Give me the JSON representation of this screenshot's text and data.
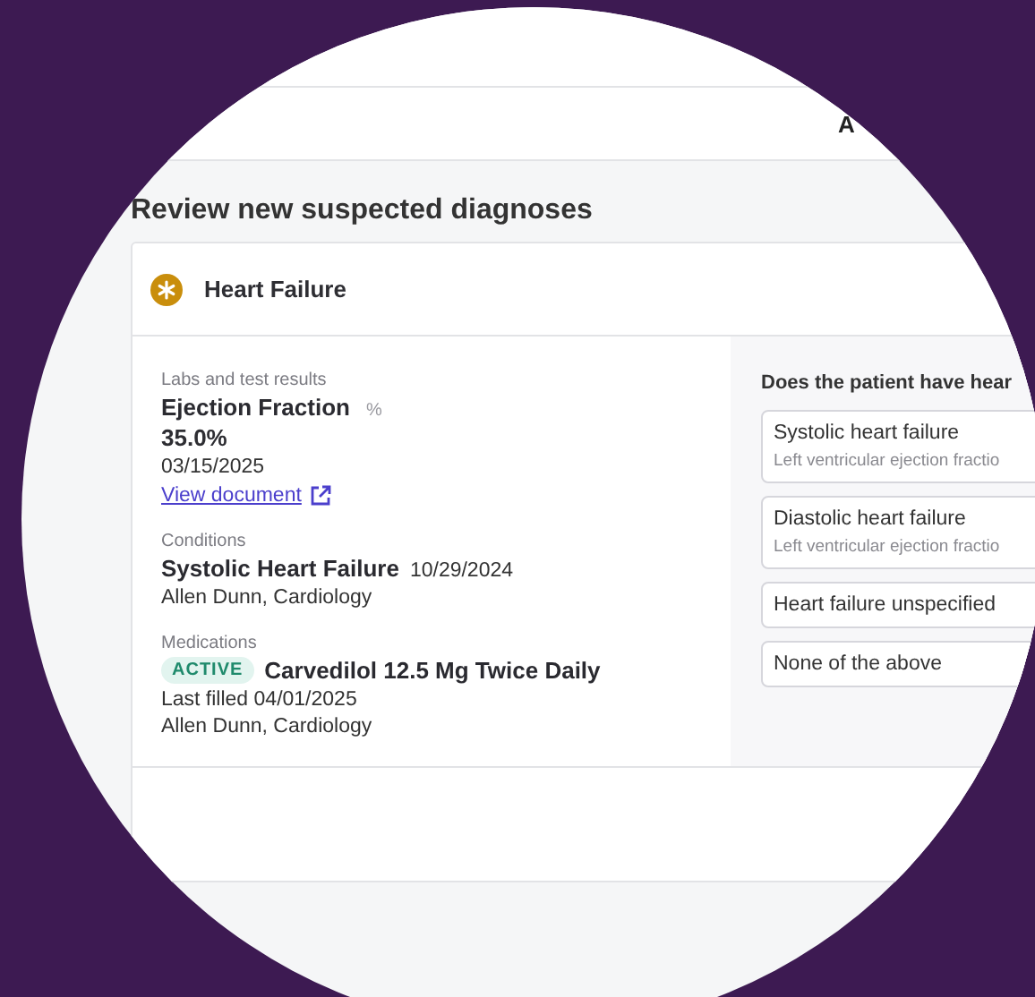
{
  "top_bar": {
    "text": "A"
  },
  "title": "Review new suspected diagnoses",
  "card": {
    "title": "Heart Failure",
    "labs": {
      "label": "Labs and test results",
      "name": "Ejection Fraction",
      "unit": "%",
      "value": "35.0%",
      "date": "03/15/2025",
      "link": "View document"
    },
    "conditions": {
      "label": "Conditions",
      "name": "Systolic Heart Failure",
      "date": "10/29/2024",
      "provider": "Allen Dunn, Cardiology"
    },
    "medications": {
      "label": "Medications",
      "status": "ACTIVE",
      "name": "Carvedilol 12.5 Mg Twice Daily",
      "last_filled": "Last filled 04/01/2025",
      "provider": "Allen Dunn, Cardiology"
    },
    "question": "Does the patient have hear",
    "options": [
      {
        "title": "Systolic heart failure",
        "subtitle": "Left ventricular ejection fractio"
      },
      {
        "title": "Diastolic heart failure",
        "subtitle": "Left ventricular ejection fractio"
      },
      {
        "title": "Heart failure unspecified"
      },
      {
        "title": "None of the above"
      }
    ]
  }
}
